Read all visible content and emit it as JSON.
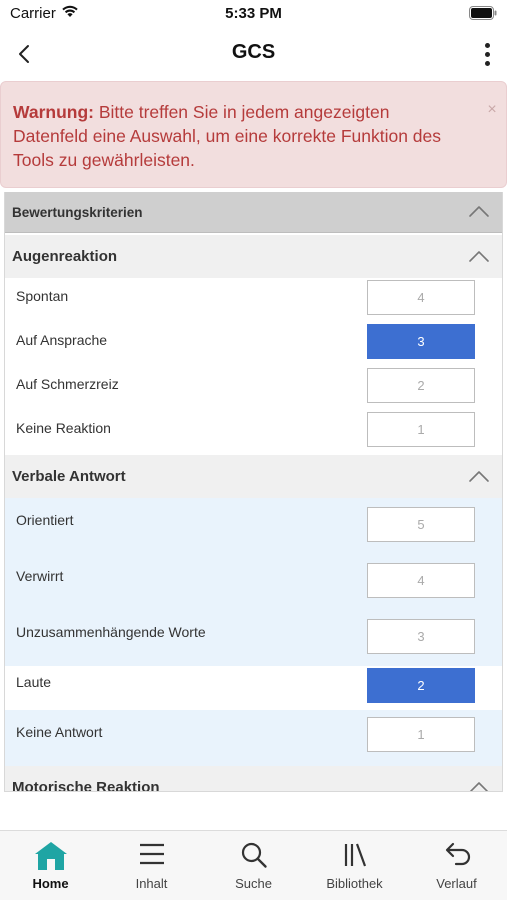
{
  "status_bar": {
    "carrier": "Carrier",
    "time": "5:33 PM"
  },
  "nav": {
    "title": "GCS"
  },
  "alert": {
    "label": "Warnung:",
    "message": " Bitte treffen Sie in jedem angezeigten Datenfeld eine Auswahl, um eine korrekte Funktion des Tools zu gewährleisten.",
    "close": "×"
  },
  "criteria_header": "Bewertungskriterien",
  "sections": [
    {
      "title": "Augenreaktion",
      "rows": [
        {
          "label": "Spontan",
          "score": "4",
          "selected": false
        },
        {
          "label": "Auf Ansprache",
          "score": "3",
          "selected": true
        },
        {
          "label": "Auf Schmerzreiz",
          "score": "2",
          "selected": false
        },
        {
          "label": "Keine Reaktion",
          "score": "1",
          "selected": false
        }
      ]
    },
    {
      "title": "Verbale Antwort",
      "rows": [
        {
          "label": "Orientiert",
          "score": "5",
          "selected": false
        },
        {
          "label": "Verwirrt",
          "score": "4",
          "selected": false
        },
        {
          "label": "Unzusammenhängende Worte",
          "score": "3",
          "selected": false
        },
        {
          "label": "Laute",
          "score": "2",
          "selected": true
        },
        {
          "label": "Keine Antwort",
          "score": "1",
          "selected": false
        }
      ]
    },
    {
      "title": "Motorische Reaktion",
      "rows": []
    }
  ],
  "tabs": [
    {
      "label": "Home",
      "icon": "home-icon",
      "active": true
    },
    {
      "label": "Inhalt",
      "icon": "menu-icon",
      "active": false
    },
    {
      "label": "Suche",
      "icon": "search-icon",
      "active": false
    },
    {
      "label": "Bibliothek",
      "icon": "library-icon",
      "active": false
    },
    {
      "label": "Verlauf",
      "icon": "undo-icon",
      "active": false
    }
  ],
  "colors": {
    "accent": "#3d6fd1",
    "alert_text": "#b53b3b",
    "alert_bg": "#f2dede",
    "row_alt_bg": "#e9f3fc",
    "home_icon": "#1fa5a4"
  }
}
